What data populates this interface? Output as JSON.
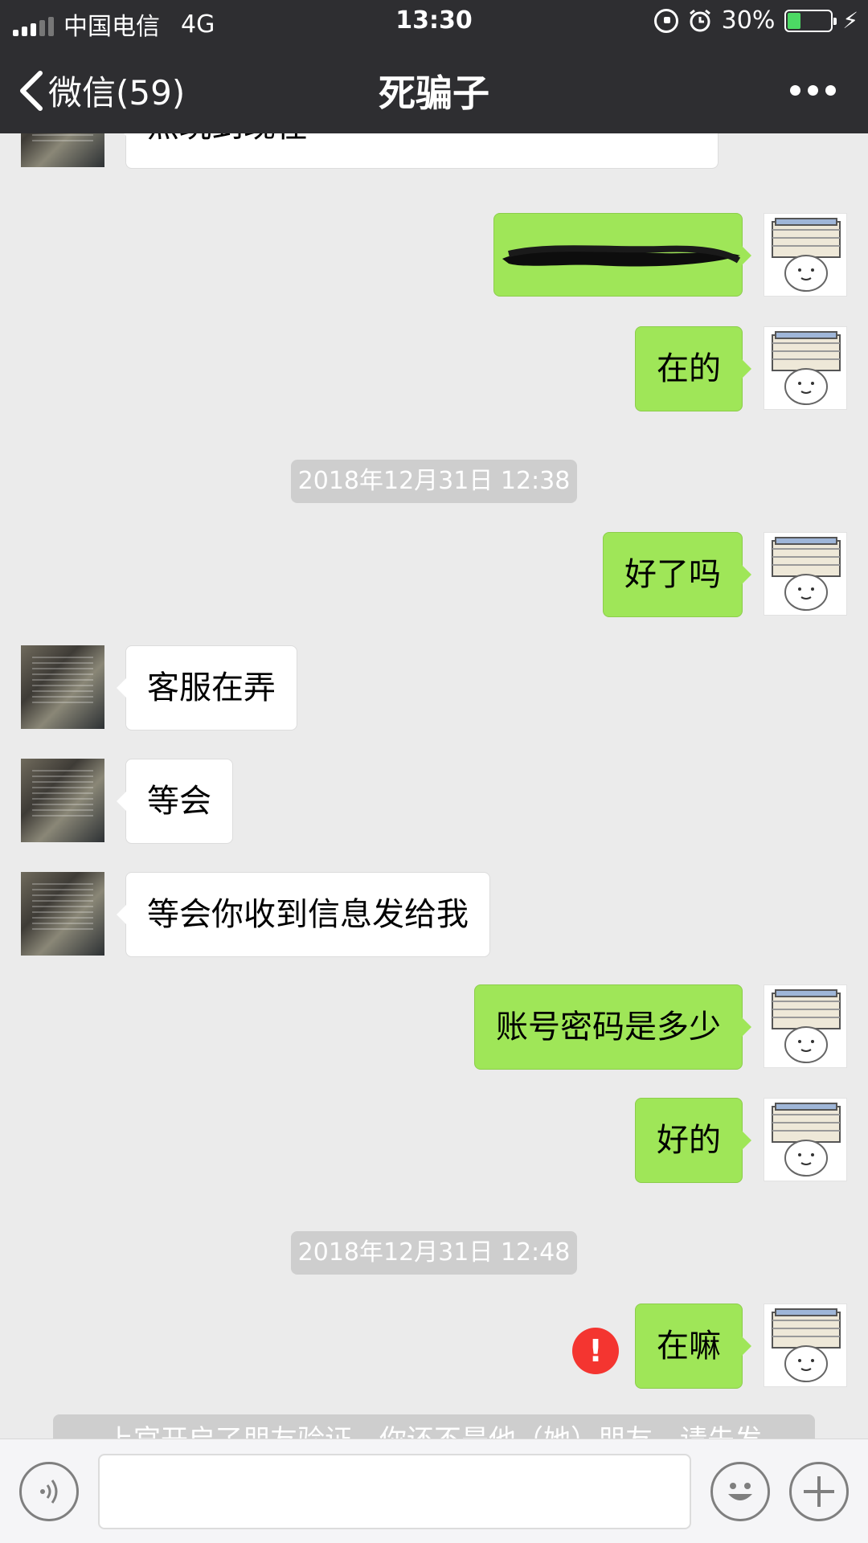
{
  "status_bar": {
    "carrier": "中国电信",
    "network": "4G",
    "time": "13:30",
    "battery_percent": "30%",
    "battery_level": 0.3,
    "icons": [
      "signal-icon",
      "rotation-lock-icon",
      "alarm-icon",
      "battery-icon",
      "charging-icon"
    ]
  },
  "nav": {
    "back_label": "微信(59)",
    "title": "死骗子",
    "more_icon": "more-icon"
  },
  "messages": {
    "m0": {
      "text": "点玩到现在"
    },
    "m1": {
      "text": ""
    },
    "m2": {
      "text": "在的"
    },
    "ts1": {
      "text": "2018年12月31日 12:38"
    },
    "m3": {
      "text": "好了吗"
    },
    "m4": {
      "text": "客服在弄"
    },
    "m5": {
      "text": "等会"
    },
    "m6": {
      "text": "等会你收到信息发给我"
    },
    "m7": {
      "text": "账号密码是多少"
    },
    "m8": {
      "text": "好的"
    },
    "ts2": {
      "text": "2018年12月31日 12:48"
    },
    "m9": {
      "text": "在嘛"
    }
  },
  "error_badge": "!",
  "system_note": "上官开启了朋友验证，你还不是他（她）朋友。请先发",
  "input_bar": {
    "placeholder": "",
    "icons": [
      "voice-icon",
      "emoji-icon",
      "plus-icon"
    ]
  },
  "colors": {
    "nav_bg": "#2e2e31",
    "chat_bg": "#ebebeb",
    "outgoing_bubble": "#9fe658",
    "incoming_bubble": "#ffffff",
    "timestamp_bg": "#cecece",
    "error_red": "#f43530",
    "battery_green": "#4cd964"
  }
}
